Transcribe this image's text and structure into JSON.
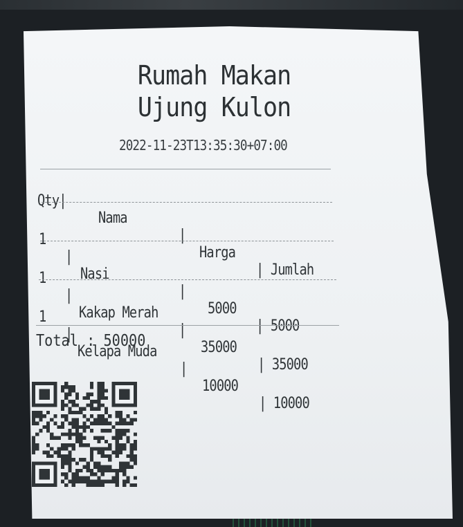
{
  "receipt": {
    "store_name_line1": "Rumah Makan",
    "store_name_line2": "Ujung Kulon",
    "timestamp": "2022-11-23T13:35:30+07:00",
    "headers": {
      "qty": "Qty|",
      "name": "Nama",
      "sep1": "|",
      "price": "Harga",
      "sep2": "| Jumlah"
    },
    "items": [
      {
        "qty": "1",
        "sep0": "|",
        "name": "Nasi",
        "sep1": "|",
        "price": "5000",
        "sep2": "| 5000"
      },
      {
        "qty": "1",
        "sep0": "|",
        "name": "Kakap Merah",
        "sep1": "|",
        "price": "35000",
        "sep2": "| 35000"
      },
      {
        "qty": "1",
        "sep0": "|",
        "name": "Kelapa Muda",
        "sep1": "|",
        "price": "10000",
        "sep2": "| 10000"
      }
    ],
    "total": "Total : 50000"
  },
  "colors": {
    "paper": "#f1f4f6",
    "ink": "#2f3437",
    "background": "#1c2024"
  },
  "icons": {
    "qr": "qr-code-icon"
  }
}
